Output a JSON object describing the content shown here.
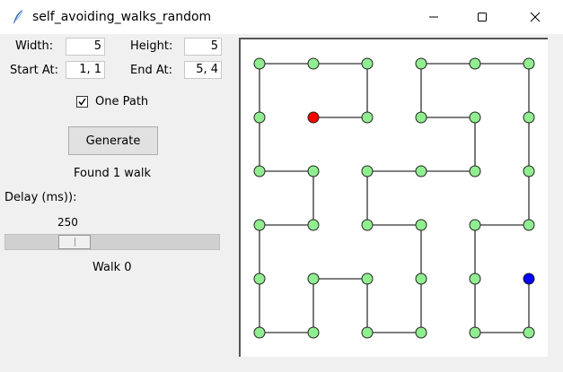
{
  "window": {
    "title": "self_avoiding_walks_random"
  },
  "form": {
    "width_label": "Width:",
    "width_value": "5",
    "height_label": "Height:",
    "height_value": "5",
    "start_label": "Start At:",
    "start_value": "1, 1",
    "end_label": "End At:",
    "end_value": "5, 4",
    "one_path_label": "One Path",
    "one_path_checked": true,
    "generate_label": "Generate",
    "status": "Found 1 walk",
    "delay_label": "Delay (ms)):",
    "delay_value": "250",
    "delay_slider_fraction": 0.29,
    "walk_label": "Walk 0"
  },
  "grid": {
    "columns": 6,
    "rows": 6,
    "path": [
      [
        2,
        2
      ],
      [
        3,
        2
      ],
      [
        3,
        1
      ],
      [
        2,
        1
      ],
      [
        1,
        1
      ],
      [
        1,
        2
      ],
      [
        1,
        3
      ],
      [
        2,
        3
      ],
      [
        2,
        4
      ],
      [
        1,
        4
      ],
      [
        1,
        5
      ],
      [
        1,
        6
      ],
      [
        2,
        6
      ],
      [
        2,
        5
      ],
      [
        3,
        5
      ],
      [
        3,
        6
      ],
      [
        4,
        6
      ],
      [
        4,
        5
      ],
      [
        4,
        4
      ],
      [
        3,
        4
      ],
      [
        3,
        3
      ],
      [
        4,
        3
      ],
      [
        5,
        3
      ],
      [
        5,
        2
      ],
      [
        4,
        2
      ],
      [
        4,
        1
      ],
      [
        5,
        1
      ],
      [
        6,
        1
      ],
      [
        6,
        2
      ],
      [
        6,
        3
      ],
      [
        6,
        4
      ],
      [
        5,
        4
      ],
      [
        5,
        5
      ],
      [
        5,
        6
      ],
      [
        6,
        6
      ],
      [
        6,
        5
      ]
    ],
    "start": [
      2,
      2
    ],
    "end": [
      6,
      5
    ],
    "colors": {
      "node": "#90ee90",
      "start": "#ff0000",
      "end": "#0000ff",
      "line": "#333333"
    }
  }
}
